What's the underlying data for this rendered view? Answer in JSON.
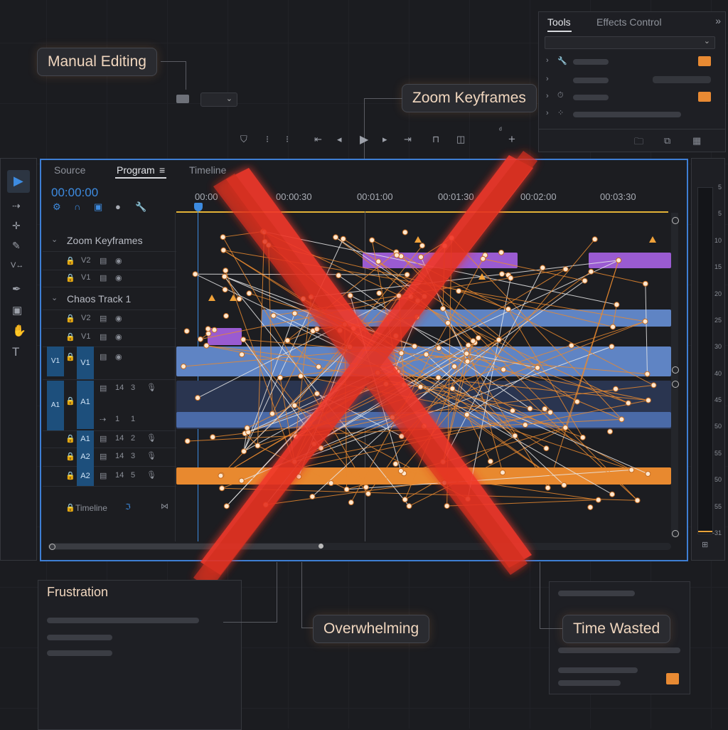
{
  "callouts": {
    "manual_editing": "Manual Editing",
    "zoom_keyframes": "Zoom Keyframes",
    "frustration": "Frustration",
    "overwhelming": "Overwhelming",
    "time_wasted": "Time Wasted"
  },
  "right_panel": {
    "tabs": [
      "Tools",
      "Effects Control"
    ],
    "expand_icon": "double-chevron-right-icon"
  },
  "monitor": {
    "tabs": [
      "Source",
      "Program",
      "Timeline"
    ],
    "timecode": "00:00:00",
    "ruler": [
      "00:00",
      "00:00:30",
      "00:01:00",
      "00:01:30",
      "00:02:00",
      "00:03:30"
    ]
  },
  "tracks": {
    "group1": "Zoom Keyframes",
    "group2": "Chaos Track 1",
    "v2": "V2",
    "v1": "V1",
    "a1": "A1",
    "a2": "A2",
    "timeline_label": "Timeline",
    "n3": "3",
    "n1": "1",
    "n2": "2",
    "n14": "14",
    "n5": "5"
  },
  "level_meter": [
    "5",
    "5",
    "10",
    "15",
    "20",
    "25",
    "30",
    "40",
    "45",
    "50",
    "55",
    "50",
    "55",
    "-31"
  ],
  "colors": {
    "accent_blue": "#3d8be0",
    "orange": "#e8892f",
    "purple": "#9a5bd1",
    "clip_blue": "#5f84c4",
    "red_x": "#f0392b"
  }
}
